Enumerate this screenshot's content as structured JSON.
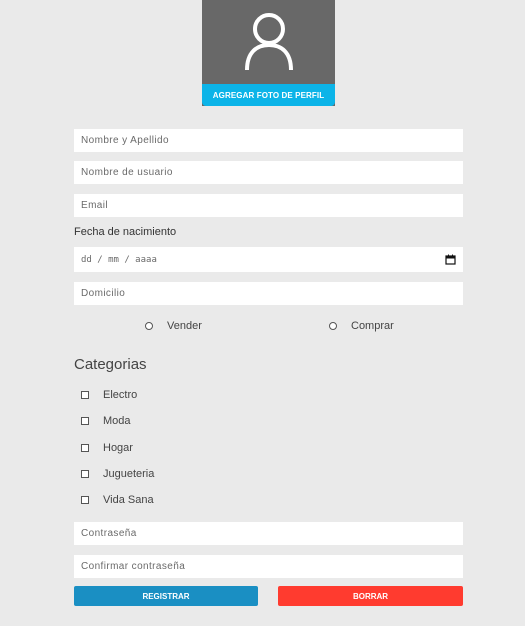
{
  "profile": {
    "avatar_icon": "user-icon",
    "add_photo_label": "AGREGAR FOTO DE PERFIL"
  },
  "form": {
    "full_name_placeholder": "Nombre y Apellido",
    "username_placeholder": "Nombre de usuario",
    "email_placeholder": "Email",
    "birthdate_label": "Fecha de nacimiento",
    "birthdate_placeholder": "dd / mm / aaaa",
    "address_placeholder": "Domicilio",
    "role_options": [
      "Vender",
      "Comprar"
    ],
    "categories_title": "Categorias",
    "categories": [
      "Electro",
      "Moda",
      "Hogar",
      "Jugueteria",
      "Vida Sana"
    ],
    "password_placeholder": "Contraseña",
    "confirm_password_placeholder": "Confirmar contraseña",
    "register_label": "REGISTRAR",
    "clear_label": "BORRAR"
  },
  "colors": {
    "background": "#eaeaea",
    "photo_bg": "#686868",
    "photo_button": "#0cb4e8",
    "register_button": "#1a8fc3",
    "clear_button": "#ff3b2f"
  }
}
